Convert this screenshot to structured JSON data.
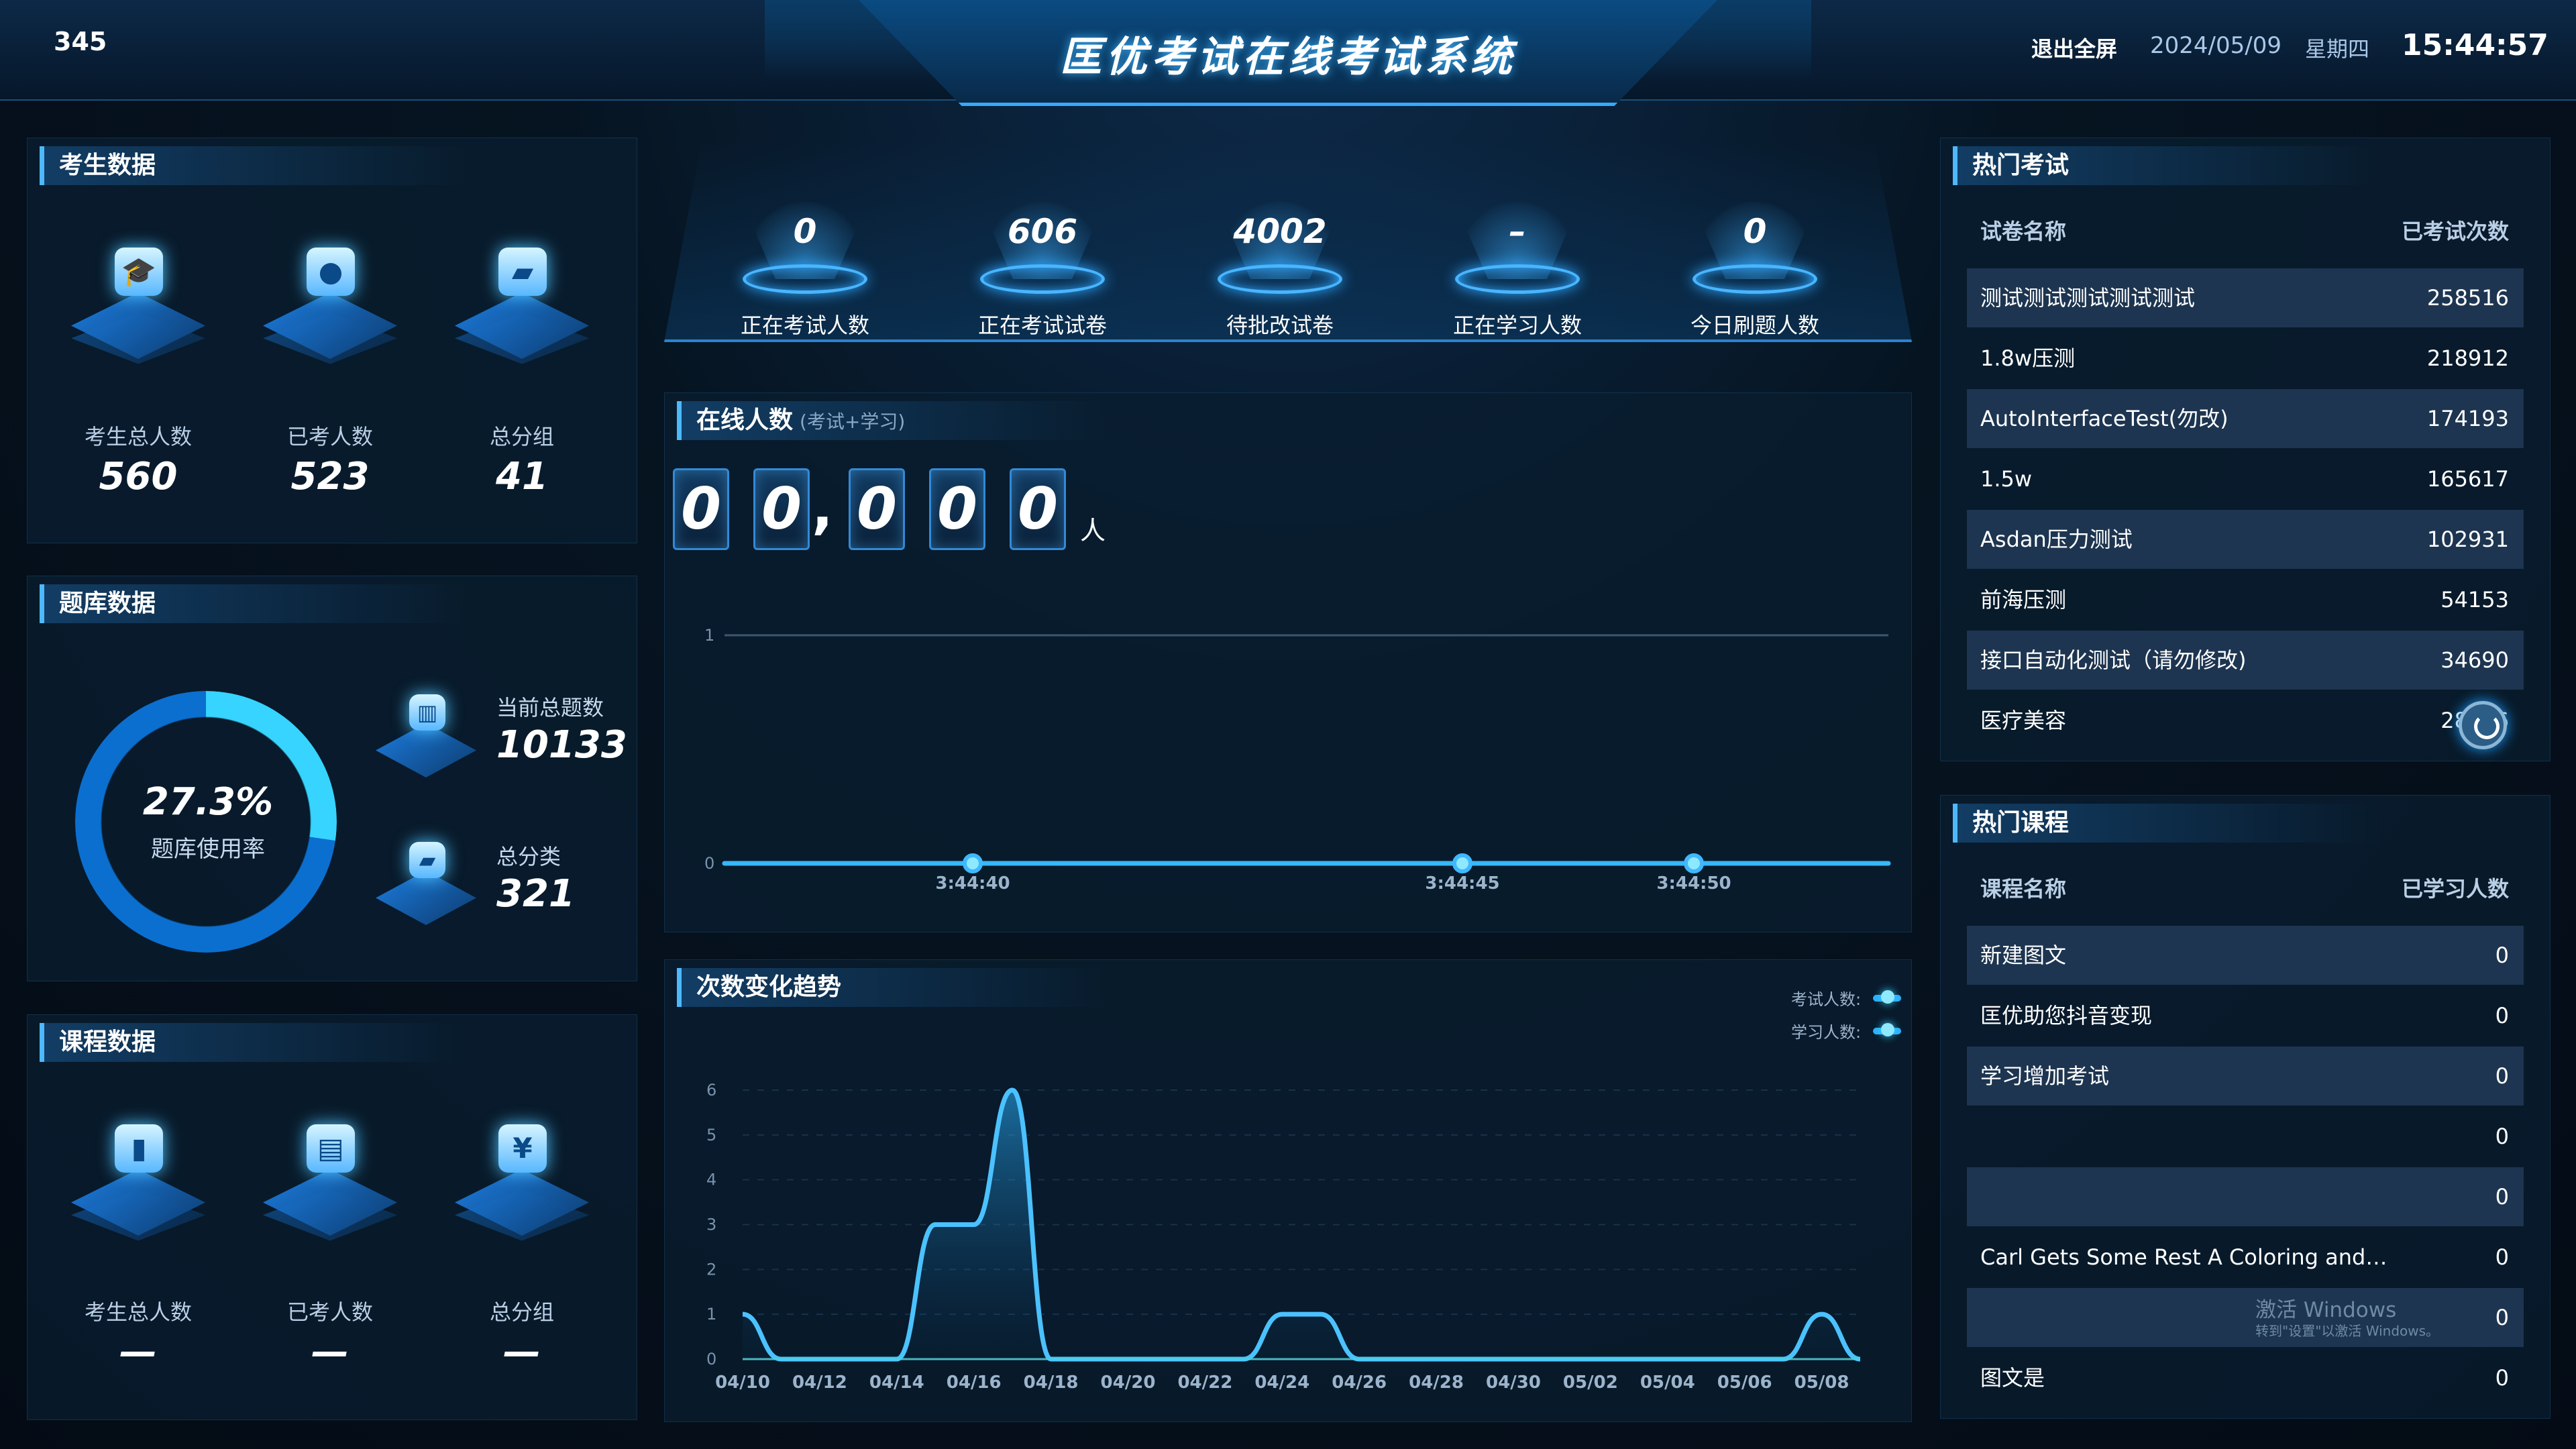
{
  "header": {
    "code": "345",
    "title": "匡优考试在线考试系统",
    "exit": "退出全屏",
    "date": "2024/05/09",
    "weekday": "星期四",
    "time": "15:44:57"
  },
  "colors": {
    "accent": "#36b7ff",
    "background": "#06121f",
    "panel": "#091d30",
    "row": "#1d3550"
  },
  "candidate": {
    "title": "考生数据",
    "stats": [
      {
        "label": "考生总人数",
        "value": "560",
        "icon": "graduation-cap-icon"
      },
      {
        "label": "已考人数",
        "value": "523",
        "icon": "user-icon"
      },
      {
        "label": "总分组",
        "value": "41",
        "icon": "folder-icon"
      }
    ]
  },
  "question_bank": {
    "title": "题库数据",
    "usage_percent": "27.3%",
    "usage_label": "题库使用率",
    "usage_fraction": 0.273,
    "items": [
      {
        "label": "当前总题数",
        "value": "10133",
        "icon": "bar-chart-icon"
      },
      {
        "label": "总分类",
        "value": "321",
        "icon": "folder-icon"
      }
    ]
  },
  "course": {
    "title": "课程数据",
    "stats": [
      {
        "label": "考生总人数",
        "value": "—",
        "icon": "book-icon"
      },
      {
        "label": "已考人数",
        "value": "—",
        "icon": "document-icon"
      },
      {
        "label": "总分组",
        "value": "—",
        "icon": "yen-icon"
      }
    ]
  },
  "top_stats": [
    {
      "value": "0",
      "label": "正在考试人数"
    },
    {
      "value": "606",
      "label": "正在考试试卷"
    },
    {
      "value": "4002",
      "label": "待批改试卷"
    },
    {
      "value": "–",
      "label": "正在学习人数"
    },
    {
      "value": "0",
      "label": "今日刷题人数"
    }
  ],
  "online": {
    "title": "在线人数",
    "subtitle": "(考试+学习)",
    "digits": [
      "0",
      "0",
      "0",
      "0",
      "0"
    ],
    "separator": ",",
    "unit": "人",
    "y_ticks": [
      "1",
      "0"
    ],
    "time_labels": [
      "3:44:40",
      "3:44:45",
      "3:44:50"
    ]
  },
  "trend": {
    "title": "次数变化趋势",
    "legend": [
      {
        "name": "考试人数:"
      },
      {
        "name": "学习人数:"
      }
    ],
    "y_ticks": [
      "6",
      "5",
      "4",
      "3",
      "2",
      "1",
      "0"
    ]
  },
  "hot_exams": {
    "title": "热门考试",
    "head_name": "试卷名称",
    "head_count": "已考试次数",
    "rows": [
      {
        "name": "测试测试测试测试测试",
        "count": "258516"
      },
      {
        "name": "1.8w压测",
        "count": "218912"
      },
      {
        "name": "AutoInterfaceTest(勿改)",
        "count": "174193"
      },
      {
        "name": "1.5w",
        "count": "165617"
      },
      {
        "name": "Asdan压力测试",
        "count": "102931"
      },
      {
        "name": "前海压测",
        "count": "54153"
      },
      {
        "name": "接口自动化测试（请勿修改)",
        "count": "34690"
      },
      {
        "name": "医疗美容",
        "count": "28906"
      }
    ]
  },
  "hot_courses": {
    "title": "热门课程",
    "head_name": "课程名称",
    "head_count": "已学习人数",
    "rows": [
      {
        "name": "新建图文",
        "count": "0"
      },
      {
        "name": "匡优助您抖音变现",
        "count": "0"
      },
      {
        "name": "学习增加考试",
        "count": "0"
      },
      {
        "name": "",
        "count": "0"
      },
      {
        "name": "",
        "count": "0"
      },
      {
        "name": "Carl Gets Some Rest A Coloring and…",
        "count": "0"
      },
      {
        "name": "",
        "count": "0"
      },
      {
        "name": "图文是",
        "count": "0"
      }
    ]
  },
  "windows_watermark": {
    "main": "激活 Windows",
    "sub": "转到\"设置\"以激活 Windows。"
  },
  "chart_data": [
    {
      "type": "line",
      "title": "在线人数",
      "x": [
        "3:44:40",
        "3:44:45",
        "3:44:50"
      ],
      "series": [
        {
          "values": [
            0,
            0,
            0
          ]
        }
      ],
      "ylim": [
        0,
        1
      ]
    },
    {
      "type": "area",
      "title": "次数变化趋势",
      "categories": [
        "04/10",
        "04/12",
        "04/14",
        "04/16",
        "04/18",
        "04/20",
        "04/22",
        "04/24",
        "04/26",
        "04/28",
        "04/30",
        "05/02",
        "05/04",
        "05/06",
        "05/08"
      ],
      "x": [
        "04/10",
        "04/11",
        "04/12",
        "04/13",
        "04/14",
        "04/15",
        "04/16",
        "04/17",
        "04/18",
        "04/19",
        "04/20",
        "04/21",
        "04/22",
        "04/23",
        "04/24",
        "04/25",
        "04/26",
        "04/27",
        "04/28",
        "04/29",
        "04/30",
        "05/01",
        "05/02",
        "05/03",
        "05/04",
        "05/05",
        "05/06",
        "05/07",
        "05/08",
        "05/09"
      ],
      "series": [
        {
          "name": "考试人数:",
          "values": [
            1,
            0,
            0,
            0,
            0,
            3,
            3,
            6,
            0,
            0,
            0,
            0,
            0,
            0,
            1,
            1,
            0,
            0,
            0,
            0,
            0,
            0,
            0,
            0,
            0,
            0,
            0,
            0,
            1,
            0
          ]
        },
        {
          "name": "学习人数:",
          "values": [
            0,
            0,
            0,
            0,
            0,
            0,
            0,
            0,
            0,
            0,
            0,
            0,
            0,
            0,
            0,
            0,
            0,
            0,
            0,
            0,
            0,
            0,
            0,
            0,
            0,
            0,
            0,
            0,
            0,
            0
          ]
        }
      ],
      "ylim": [
        0,
        6
      ]
    }
  ]
}
